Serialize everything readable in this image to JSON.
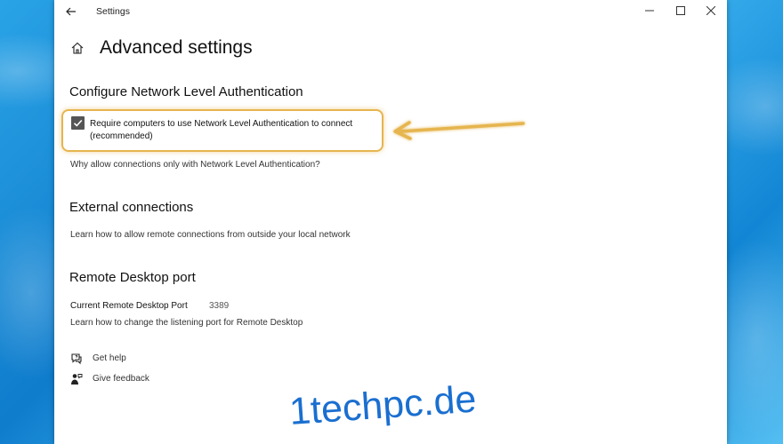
{
  "window": {
    "title": "Settings",
    "back_icon": "back-arrow-icon",
    "controls": {
      "minimize": "minimize-icon",
      "maximize": "maximize-icon",
      "close": "close-icon"
    }
  },
  "header": {
    "home_icon": "home-icon",
    "title": "Advanced settings"
  },
  "nla": {
    "title": "Configure Network Level Authentication",
    "checkbox_label": "Require computers to use Network Level Authentication to connect (recommended)",
    "checkbox_checked": true,
    "link": "Why allow connections only with Network Level Authentication?"
  },
  "external": {
    "title": "External connections",
    "link": "Learn how to allow remote connections from outside your local network"
  },
  "rdp_port": {
    "title": "Remote Desktop port",
    "label": "Current Remote Desktop Port",
    "value": "3389",
    "link": "Learn how to change the listening port for Remote Desktop"
  },
  "footer": {
    "help": {
      "label": "Get help",
      "icon": "help-chat-icon"
    },
    "feedback": {
      "label": "Give feedback",
      "icon": "feedback-person-icon"
    }
  },
  "annotation": {
    "highlight_color": "#e6b54f"
  },
  "watermark": "1techpc.de"
}
